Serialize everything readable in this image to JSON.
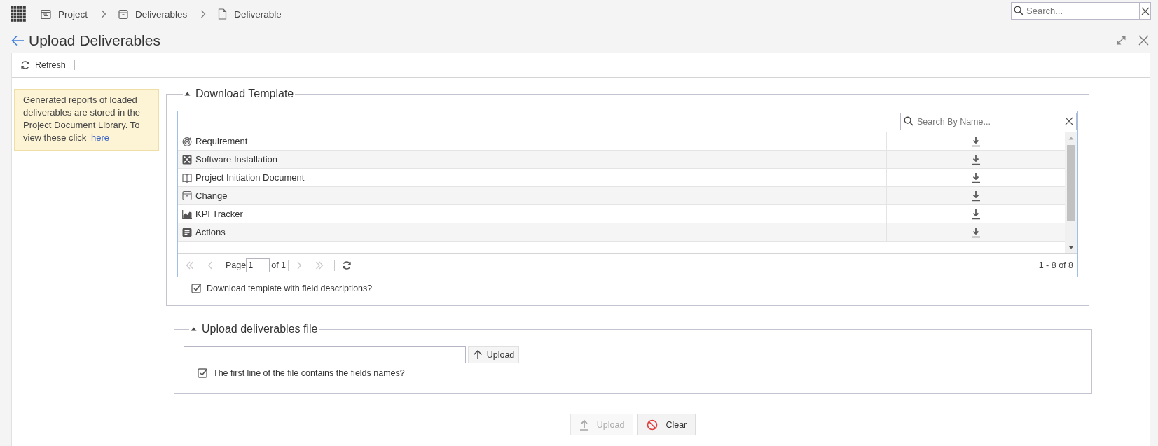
{
  "topbar": {
    "breadcrumbs": [
      {
        "label": "Project",
        "kind": "form"
      },
      {
        "label": "Deliverables",
        "kind": "box"
      },
      {
        "label": "Deliverable",
        "kind": "page"
      }
    ],
    "search": {
      "placeholder": "Search..."
    }
  },
  "page": {
    "title": "Upload Deliverables"
  },
  "toolbar": {
    "buttons": [
      {
        "label": "Refresh",
        "kind": "refresh"
      }
    ]
  },
  "notice": {
    "text": "Generated reports of loaded deliverables are stored in the Project Document Library. To view these click",
    "link": "here"
  },
  "download_template": {
    "title": "Download Template",
    "expanded": true,
    "search": {
      "placeholder": "Search By Name..."
    },
    "rows": [
      {
        "label": "Requirement",
        "kind": "target"
      },
      {
        "label": "Software Installation",
        "kind": "network"
      },
      {
        "label": "Project Initiation Document",
        "kind": "book"
      },
      {
        "label": "Change",
        "kind": "box"
      },
      {
        "label": "KPI Tracker",
        "kind": "chart"
      },
      {
        "label": "Actions",
        "kind": "note"
      }
    ],
    "pager": {
      "nav": [
        {
          "kind": "first",
          "disabled": true
        },
        {
          "kind": "prev",
          "disabled": true
        },
        {
          "kind": "next",
          "disabled": true
        },
        {
          "kind": "last",
          "disabled": true
        }
      ],
      "page_label": "Page",
      "page": "1",
      "page_count": "of 1",
      "summary": "1 - 8 of 8"
    },
    "option": {
      "label": "Download template with field descriptions?",
      "checked": true
    }
  },
  "upload_file": {
    "title": "Upload deliverables file",
    "expanded": true,
    "button": {
      "label": "Upload"
    },
    "option": {
      "label": "The first line of the file contains the fields names?",
      "checked": true
    }
  },
  "actions": [
    {
      "label": "Upload",
      "kind": "upload",
      "disabled": true
    },
    {
      "label": "Clear",
      "kind": "clear",
      "disabled": false
    }
  ]
}
